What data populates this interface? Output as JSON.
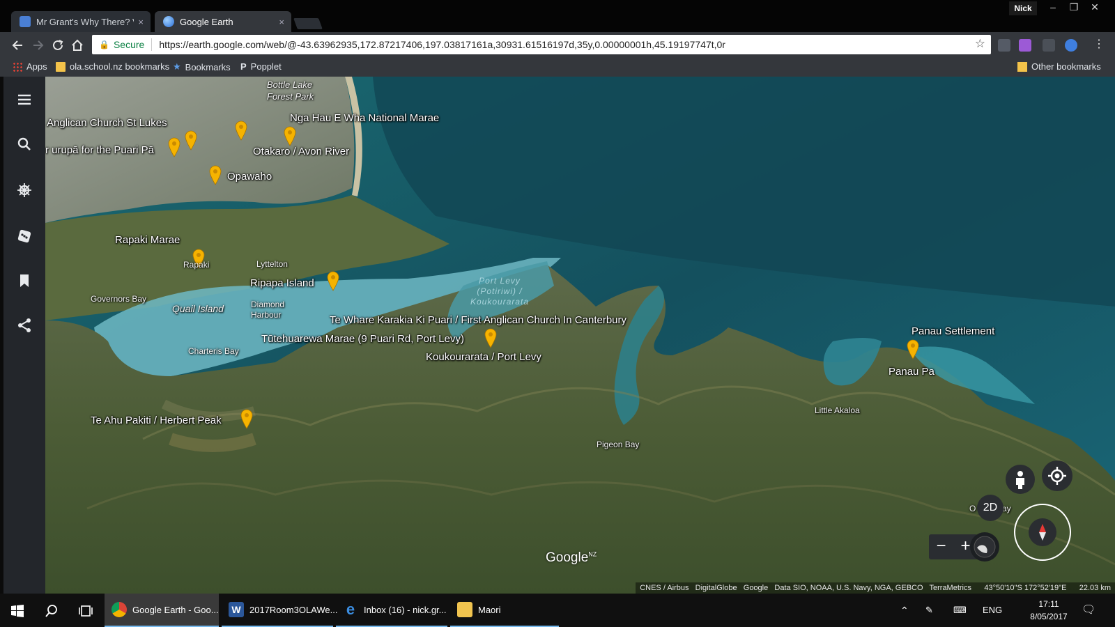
{
  "browser": {
    "profile_name": "Nick",
    "tabs": [
      {
        "title": "Mr Grant's Why There? V",
        "active": false,
        "close": "×"
      },
      {
        "title": "Google Earth",
        "active": true,
        "close": "×"
      }
    ],
    "window_controls": {
      "minimize": "–",
      "maximize": "❐",
      "close": "✕"
    },
    "address": {
      "secure_label": "Secure",
      "url": "https://earth.google.com/web/@-43.63962935,172.87217406,197.03817161a,30931.61516197d,35y,0.00000001h,45.19197747t,0r"
    },
    "bookmarks": [
      {
        "label": "Apps",
        "icon": "apps-grid-icon"
      },
      {
        "label": "ola.school.nz bookmarks",
        "icon": "folder-icon"
      },
      {
        "label": "Bookmarks",
        "icon": "star-icon"
      },
      {
        "label": "Popplet",
        "icon": "popplet-icon"
      }
    ],
    "other_bookmarks": "Other bookmarks"
  },
  "map": {
    "places": {
      "bottle_lake": "Bottle Lake\nForest Park",
      "anglican": "Anglican Church St Lukes",
      "urupa": "r urupā for the Puari Pā",
      "nga_hau": "Nga Hau E Wha National Marae",
      "otakaro": "Otakaro / Avon River",
      "opawaho": "Opawaho",
      "rapaki_marae": "Rapaki Marae",
      "ripapa": "Ripapa Island",
      "te_whare": "Te Whare Karakia Ki Puari / First Anglican Church In Canterbury",
      "tutehuarewa": "Tūtehuarewa Marae (9 Puari Rd, Port Levy)",
      "koukourarata": "Koukourarata / Port Levy",
      "panau_settlement": "Panau Settlement",
      "panau_pa": "Panau Pa",
      "te_ahu": "Te Ahu Pakiti / Herbert Peak"
    },
    "minor_places": {
      "rapaki": "Rapaki",
      "lyttelton": "Lyttelton",
      "governors_bay": "Governors Bay",
      "quail_island": "Quail Island",
      "diamond_harbour": "Diamond\nHarbour",
      "charteris_bay": "Charteris Bay",
      "little_akaloa": "Little Akaloa",
      "pigeon_bay": "Pigeon Bay",
      "okains_prefix": "O",
      "okains_suffix": "ay"
    },
    "water_label": "Port Levy\n(Potiriwi) /\nKoukourarata",
    "controls": {
      "view_mode": "2D",
      "zoom_out": "−",
      "zoom_in": "+"
    },
    "logo": {
      "text": "Google",
      "region": "NZ"
    },
    "attribution": "CNES / Airbus   DigitalGlobe   Google   Data SIO, NOAA, U.S. Navy, NGA, GEBCO   TerraMetrics      43°50'10\"S 172°52'19\"E      22.03 km",
    "pin_color": "#f6b300"
  },
  "taskbar": {
    "apps": [
      {
        "label": "Google Earth - Goo...",
        "active": true
      },
      {
        "label": "2017Room3OLAWe...",
        "active": false
      },
      {
        "label": "Inbox (16) - nick.gr...",
        "active": false
      },
      {
        "label": "Maori",
        "active": false
      }
    ],
    "language": "ENG",
    "time": "17:11",
    "date": "8/05/2017"
  }
}
